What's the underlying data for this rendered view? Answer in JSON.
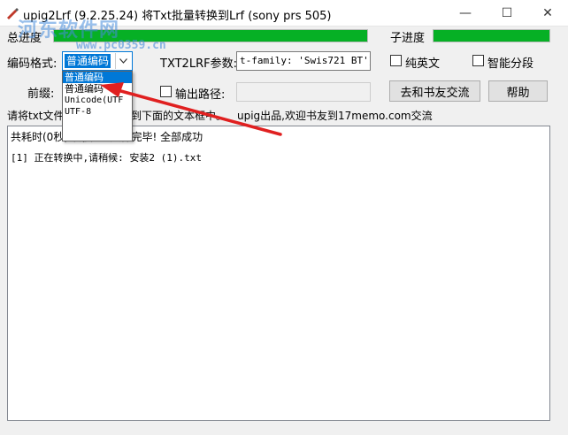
{
  "window": {
    "title": "upig2Lrf (9.2.25.24) 将Txt批量转换到Lrf (sony prs 505)",
    "minimize_glyph": "—",
    "maximize_glyph": "☐",
    "close_glyph": "✕"
  },
  "progress": {
    "total_label": "总进度",
    "total_value": 1.0,
    "sub_label": "子进度",
    "sub_value": 1.0,
    "fill_color": "#06b025"
  },
  "encoding": {
    "label": "编码格式:",
    "selected": "普通编码",
    "options": [
      "普通编码",
      "普通编码",
      "Unicode(UTF",
      "UTF-8"
    ]
  },
  "txt2lrf": {
    "label": "TXT2LRF参数:",
    "value": "t-family: 'Swis721 BT'}\""
  },
  "checkboxes": {
    "pure_english": "纯英文",
    "smart_paragraph": "智能分段",
    "output_path": "输出路径:"
  },
  "prefix": {
    "label": "前缀:"
  },
  "buttons": {
    "forum": "去和书友交流",
    "help": "帮助"
  },
  "info": {
    "left_visible": "请将txt文件",
    "left_partial": "到下面的文本框中。",
    "right": "upig出品,欢迎书友到17memo.com交流"
  },
  "log": {
    "line1": "共耗时(0秒) 转换1个文件完毕! 全部成功",
    "line2": "[1]  正在转换中,请稍候: 安装2 (1).txt"
  },
  "watermark": {
    "main": "河东软件网",
    "url": "www.pc0359.cn"
  },
  "colors": {
    "accent": "#0078d7",
    "arrow": "#e02020"
  }
}
